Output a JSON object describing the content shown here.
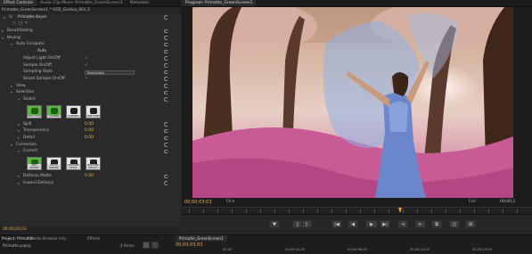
{
  "effect_controls_tabs": [
    "Effect Controls",
    "Audio Clip Mixer: Primatte_GreenScreen1",
    "Metadata"
  ],
  "program_tabs": [
    "Program: Primatte_GreenScreen1"
  ],
  "effect_controls": {
    "clip_header": "Primatte_GreenScreen1 * HD5_Godiva_001.2",
    "effect_name": "Primatte Keyer",
    "rows": [
      {
        "label": "Deartifacting",
        "indent": 8,
        "tri": "▸"
      },
      {
        "label": "Keying",
        "indent": 8,
        "tri": "▾"
      },
      {
        "label": "Auto Compute",
        "indent": 18,
        "tri": "▾"
      },
      {
        "label": "Auto",
        "indent": 42,
        "tri": ""
      },
      {
        "label": "Adjust Light On/Off",
        "indent": 26,
        "tri": "",
        "check": true
      },
      {
        "label": "Sample On/Off",
        "indent": 26,
        "tri": "",
        "check": true
      },
      {
        "label": "Sampling Style",
        "indent": 26,
        "tri": "",
        "dropdown": "Rectangle"
      },
      {
        "label": "Smart Sample On/Off",
        "indent": 26,
        "tri": "",
        "check": true
      },
      {
        "label": "View",
        "indent": 18,
        "tri": "▸"
      },
      {
        "label": "Selection",
        "indent": 18,
        "tri": "▾"
      },
      {
        "label": "Select",
        "indent": 26,
        "tri": "▾"
      }
    ],
    "select_tiles": [
      "SELECTION",
      "CLEANBG",
      "CLEANFG",
      "FINE TUNE"
    ],
    "selection_values": [
      {
        "label": "Spill",
        "value": "0.00"
      },
      {
        "label": "Transparency",
        "value": "0.00"
      },
      {
        "label": "Detail",
        "value": "0.00"
      }
    ],
    "correction_rows": [
      {
        "label": "Correction",
        "indent": 18,
        "tri": "▾"
      },
      {
        "label": "Correct",
        "indent": 26,
        "tri": "▾"
      }
    ],
    "correct_tiles": [
      "SPILL SPONGE",
      "MATTE SPONGE",
      "RESTORE DETAIL",
      "RESTORE OPACITY"
    ],
    "tail_rows": [
      {
        "label": "Defocus Matte",
        "value": "0.00"
      },
      {
        "label": "Inward Defocus",
        "value": ""
      }
    ],
    "timecode": "00;00;03;03"
  },
  "program": {
    "timecode_left": "00;00;03;03",
    "fit_label": "Fit",
    "full_label": "Full",
    "timecode_right": "00;00;1",
    "transport_buttons": [
      "▼",
      "{",
      "}",
      "|◀",
      "◀",
      "▶",
      "▶|",
      "⇥",
      "⇤",
      "⧉",
      "◫",
      "⊞"
    ]
  },
  "bottom": {
    "project_tabs": [
      "Project: Primatte",
      "Media Browser",
      "Info",
      "Effects"
    ],
    "project_file": "Primatte.prproj",
    "items_count": "4 Items",
    "timeline_tab": "Primatte_GreenScreen1",
    "timeline_tc": "00;00;03;03",
    "ruler_times": [
      "00;00",
      "00;00;04;00",
      "00;00;08;00",
      "00;00;12;00",
      "00;00;16;00"
    ]
  },
  "colors": {
    "accent": "#e8b14a",
    "check": "#9ad14a",
    "tile_green": "#57b83a"
  }
}
